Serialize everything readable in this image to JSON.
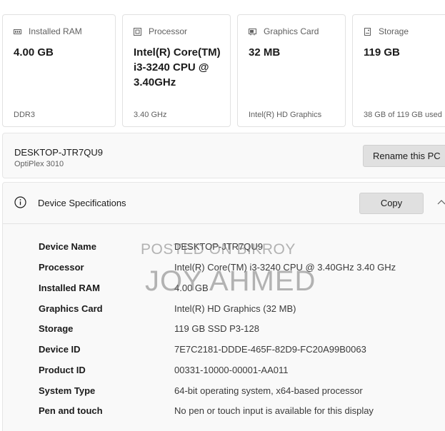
{
  "cards": [
    {
      "title": "Installed RAM",
      "icon": "ram-icon",
      "value": "4.00 GB",
      "footer": "DDR3"
    },
    {
      "title": "Processor",
      "icon": "processor-icon",
      "value": "Intel(R) Core(TM) i3-3240 CPU @ 3.40GHz",
      "footer": "3.40 GHz"
    },
    {
      "title": "Graphics Card",
      "icon": "graphics-card-icon",
      "value": "32 MB",
      "footer": "Intel(R) HD Graphics"
    },
    {
      "title": "Storage",
      "icon": "storage-icon",
      "value": "119 GB",
      "footer": "38 GB of 119 GB used"
    }
  ],
  "device": {
    "name": "DESKTOP-JTR7QU9",
    "model": "OptiPlex 3010",
    "rename_label": "Rename this PC"
  },
  "specs": {
    "title": "Device Specifications",
    "copy_label": "Copy",
    "rows": [
      {
        "label": "Device Name",
        "value": "DESKTOP-JTR7QU9"
      },
      {
        "label": "Processor",
        "value": "Intel(R) Core(TM) i3-3240 CPU @ 3.40GHz   3.40 GHz"
      },
      {
        "label": "Installed RAM",
        "value": "4.00 GB"
      },
      {
        "label": "Graphics Card",
        "value": "Intel(R) HD Graphics (32 MB)"
      },
      {
        "label": "Storage",
        "value": "119 GB SSD P3-128"
      },
      {
        "label": "Device ID",
        "value": "7E7C2181-DDDE-465F-82D9-FC20A99B0063"
      },
      {
        "label": "Product ID",
        "value": "00331-10000-00001-AA011"
      },
      {
        "label": "System Type",
        "value": "64-bit operating system, x64-based processor"
      },
      {
        "label": "Pen and touch",
        "value": "No pen or touch input is available for this display"
      }
    ]
  },
  "watermark": {
    "line1": "POSTED ON BIKROY",
    "line2": "JOY AHMED"
  },
  "colors": {
    "panel_bg": "#f9f9f9",
    "button_bg": "#e0e0e0",
    "muted_text": "#5f5f5f"
  }
}
